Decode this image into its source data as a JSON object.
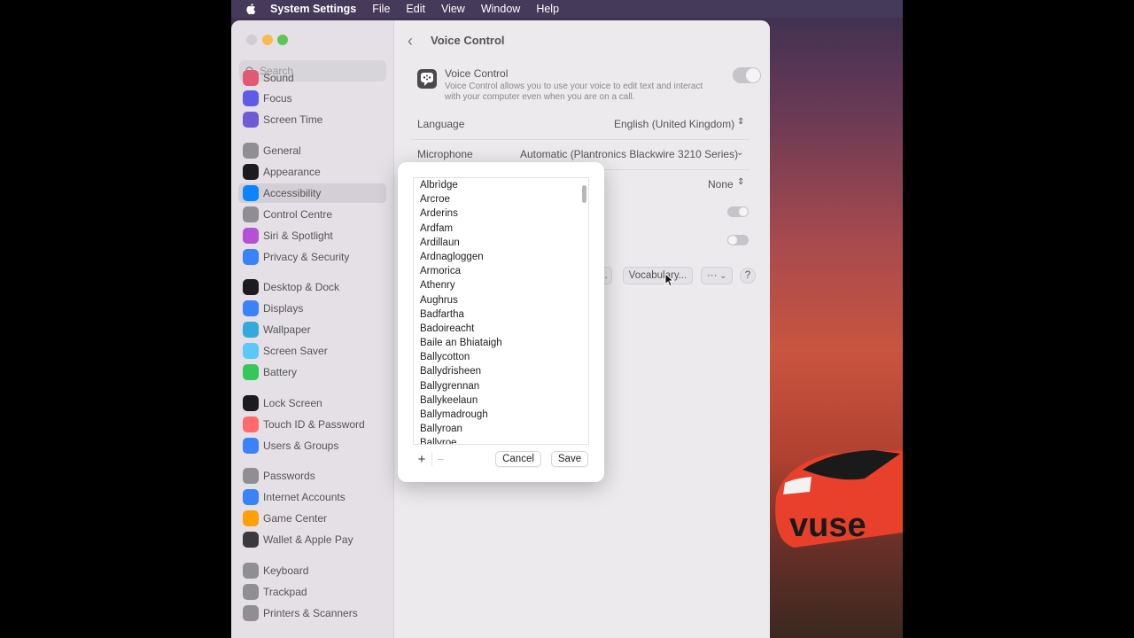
{
  "menubar": {
    "app": "System Settings",
    "items": [
      "File",
      "Edit",
      "View",
      "Window",
      "Help"
    ]
  },
  "search": {
    "placeholder": "Search"
  },
  "sidebar": {
    "items": [
      {
        "label": "Sound",
        "color": "#e05a73"
      },
      {
        "label": "Focus",
        "color": "#5e5ce6"
      },
      {
        "label": "Screen Time",
        "color": "#6e5bd6"
      },
      {
        "label": "General",
        "color": "#8e8e93"
      },
      {
        "label": "Appearance",
        "color": "#1c1c1e"
      },
      {
        "label": "Accessibility",
        "color": "#0a84ff"
      },
      {
        "label": "Control Centre",
        "color": "#8e8e93"
      },
      {
        "label": "Siri & Spotlight",
        "color": "#b451d6"
      },
      {
        "label": "Privacy & Security",
        "color": "#3a82f7"
      },
      {
        "label": "Desktop & Dock",
        "color": "#1c1c1e"
      },
      {
        "label": "Displays",
        "color": "#3a82f7"
      },
      {
        "label": "Wallpaper",
        "color": "#34aadc"
      },
      {
        "label": "Screen Saver",
        "color": "#5ac8fa"
      },
      {
        "label": "Battery",
        "color": "#34c759"
      },
      {
        "label": "Lock Screen",
        "color": "#1c1c1e"
      },
      {
        "label": "Touch ID & Password",
        "color": "#ff6b6b"
      },
      {
        "label": "Users & Groups",
        "color": "#3a82f7"
      },
      {
        "label": "Passwords",
        "color": "#8e8e93"
      },
      {
        "label": "Internet Accounts",
        "color": "#3a82f7"
      },
      {
        "label": "Game Center",
        "color": "#ff9f0a"
      },
      {
        "label": "Wallet & Apple Pay",
        "color": "#3a3a3c"
      },
      {
        "label": "Keyboard",
        "color": "#8e8e93"
      },
      {
        "label": "Trackpad",
        "color": "#8e8e93"
      },
      {
        "label": "Printers & Scanners",
        "color": "#8e8e93"
      }
    ]
  },
  "content": {
    "title": "Voice Control",
    "vc_title": "Voice Control",
    "vc_desc": "Voice Control allows you to use your voice to edit text and interact with your computer even when you are on a call.",
    "language_label": "Language",
    "language_value": "English (United Kingdom)",
    "microphone_label": "Microphone",
    "microphone_value": "Automatic (Plantronics Blackwire 3210 Series)",
    "none_value": "None",
    "ellipsis_btn": "...",
    "vocabulary_btn": "Vocabulary...",
    "more_btn": "···",
    "help_btn": "?"
  },
  "sheet": {
    "words": [
      "Albrìdge",
      "Arcroe",
      "Arderins",
      "Ardfam",
      "Ardillaun",
      "Ardnagloggen",
      "Armorica",
      "Athenry",
      "Aughrus",
      "Badfartha",
      "Badoireacht",
      "Baile an Bhiataigh",
      "Ballycotton",
      "Ballydrisheen",
      "Ballygrennan",
      "Ballykeelaun",
      "Ballymadrough",
      "Ballyroan",
      "Ballyroe"
    ],
    "add": "+",
    "remove": "−",
    "cancel": "Cancel",
    "save": "Save"
  },
  "wallpaper": {
    "brand_text": "vuse"
  }
}
